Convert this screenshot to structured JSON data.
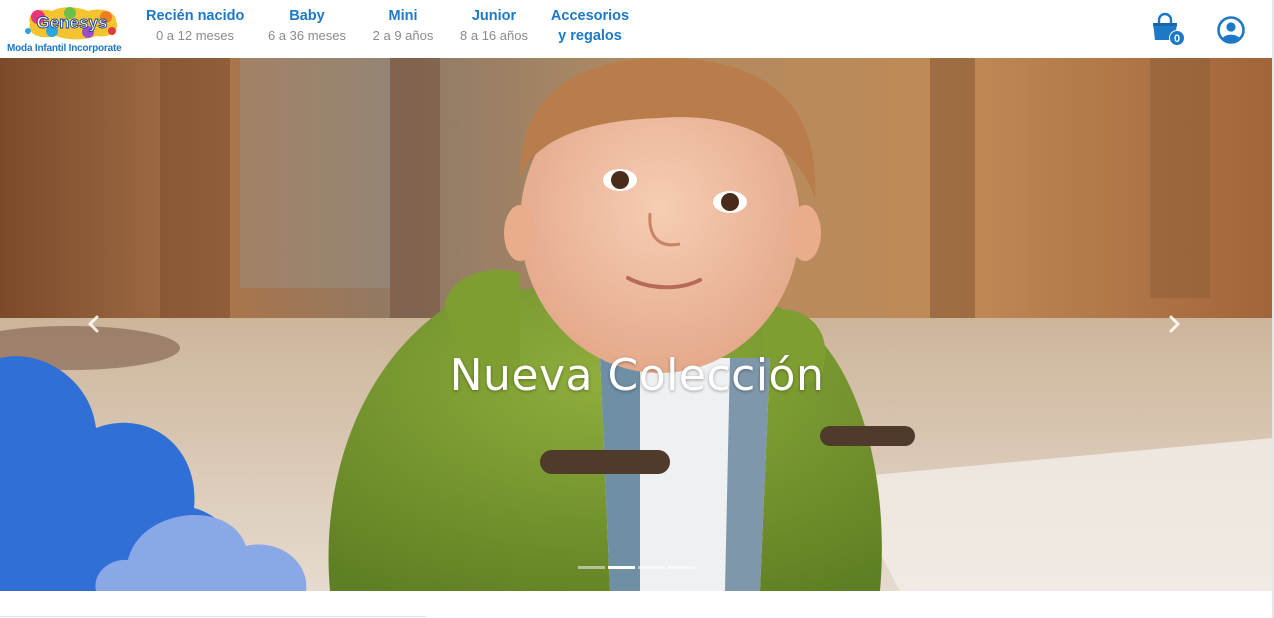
{
  "brand": {
    "logo_text": "Genesys",
    "tagline": "Moda Infantil Incorporate",
    "color": "#1d78c8"
  },
  "nav": {
    "items": [
      {
        "title": "Recién nacido",
        "sub": "0 a 12 meses"
      },
      {
        "title": "Baby",
        "sub": "6 a 36 meses"
      },
      {
        "title": "Mini",
        "sub": "2 a 9 años"
      },
      {
        "title": "Junior",
        "sub": "8 a 16 años"
      },
      {
        "title": "Accesorios",
        "sub": "y regalos"
      }
    ]
  },
  "header_icons": {
    "cart_icon": "shopping-bag-icon",
    "cart_count": "0",
    "account_icon": "user-circle-icon"
  },
  "hero": {
    "caption": "Nueva Colección",
    "slide_count": 4,
    "active_slide": 2,
    "prev_icon": "chevron-left-icon",
    "next_icon": "chevron-right-icon",
    "cloud_colors": [
      "#2f6fd6",
      "#8aa7e6"
    ]
  }
}
